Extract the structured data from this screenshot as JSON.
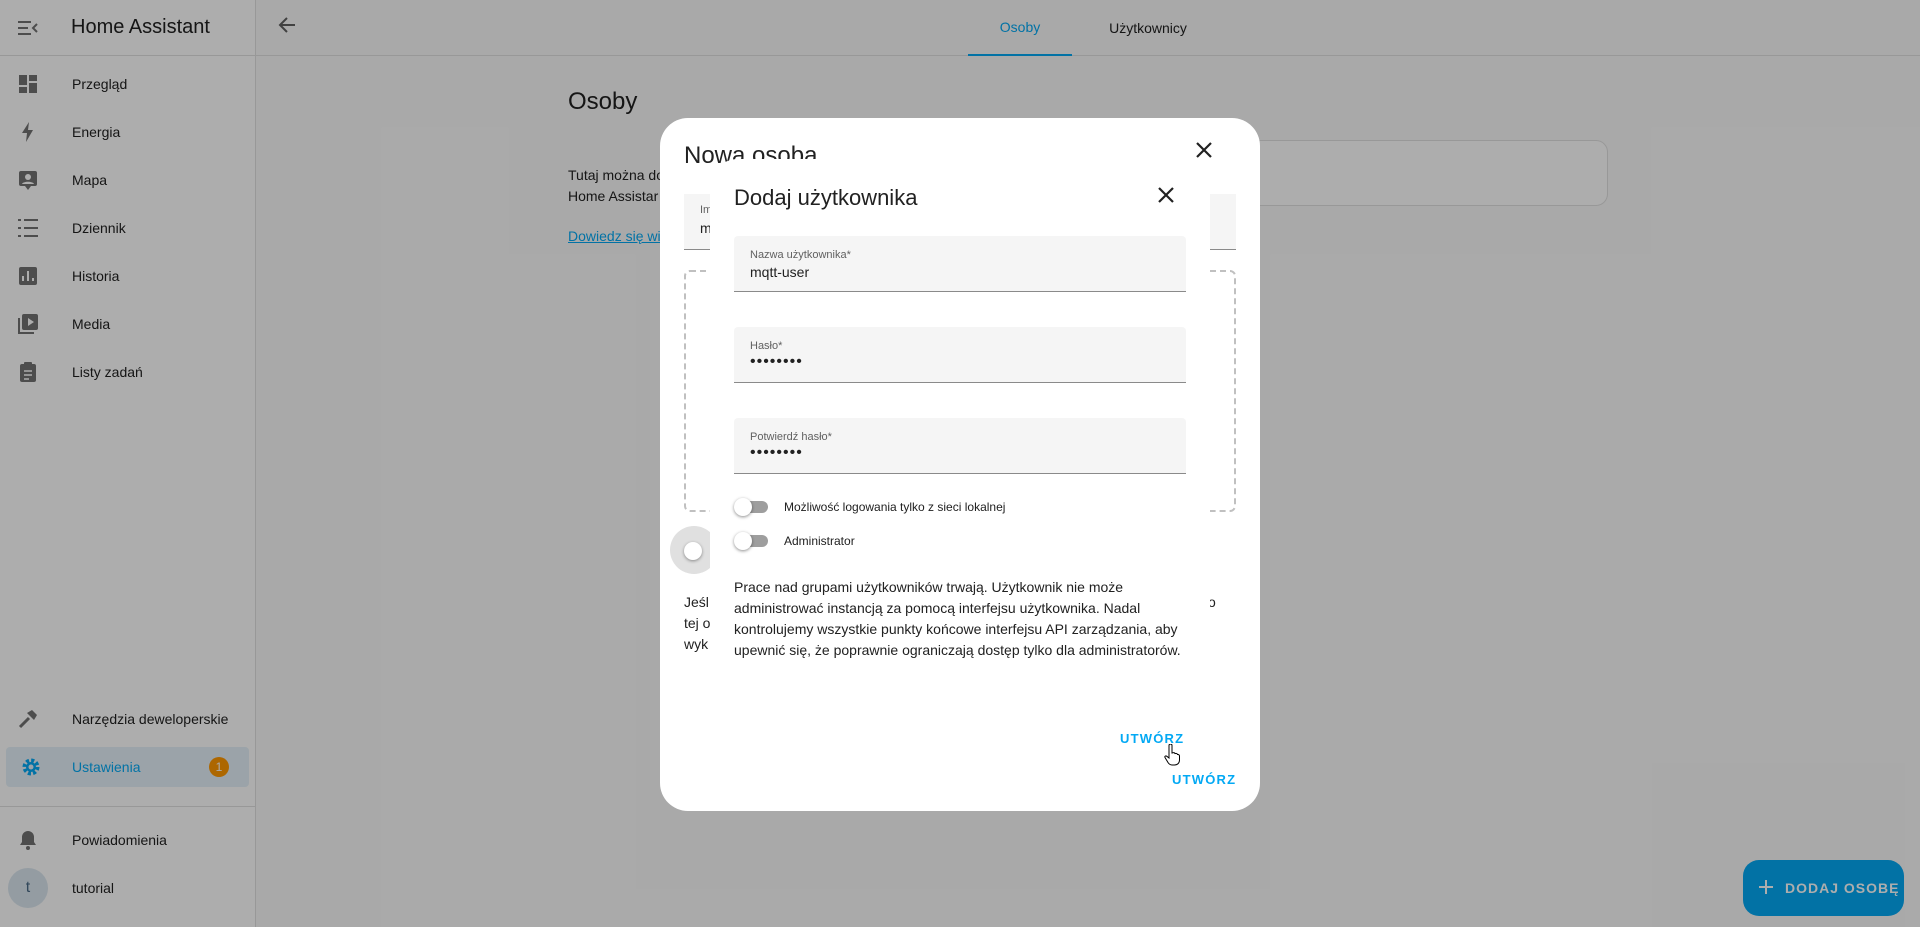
{
  "app": {
    "title": "Home Assistant"
  },
  "sidebar": {
    "items": [
      {
        "label": "Przegląd",
        "icon": "dashboard-icon"
      },
      {
        "label": "Energia",
        "icon": "lightning-icon"
      },
      {
        "label": "Mapa",
        "icon": "map-account-icon"
      },
      {
        "label": "Dziennik",
        "icon": "format-list-icon"
      },
      {
        "label": "Historia",
        "icon": "chart-box-icon"
      },
      {
        "label": "Media",
        "icon": "play-box-multiple-icon"
      },
      {
        "label": "Listy zadań",
        "icon": "clipboard-list-icon"
      }
    ],
    "dev_tools": "Narzędzia deweloperskie",
    "settings": {
      "label": "Ustawienia",
      "badge": "1"
    },
    "notifications": "Powiadomienia",
    "user": {
      "name": "tutorial",
      "initial": "t"
    }
  },
  "topbar": {
    "tabs": [
      "Osoby",
      "Użytkownicy"
    ],
    "active_tab": "Osoby"
  },
  "page": {
    "title": "Osoby",
    "desc_line1": "Tutaj można do",
    "desc_line2": "Home Assistar",
    "link": "Dowiedz się wię"
  },
  "fab": {
    "label": "DODAJ OSOBĘ"
  },
  "person_dialog": {
    "title": "Nowa osoba",
    "field_label": "Im",
    "field_value": "m",
    "text_line1": "Jeśl",
    "text_line2": "tej o",
    "text_line3": "wyk",
    "text_right": "o",
    "submit": "UTWÓRZ"
  },
  "user_dialog": {
    "title": "Dodaj użytkownika",
    "username": {
      "label": "Nazwa użytkownika*",
      "value": "mqtt-user"
    },
    "password": {
      "label": "Hasło*",
      "value": "••••••••"
    },
    "confirm_password": {
      "label": "Potwierdź hasło*",
      "value": "••••••••"
    },
    "local_only": {
      "label": "Możliwość logowania tylko z sieci lokalnej",
      "checked": false
    },
    "admin": {
      "label": "Administrator",
      "checked": false
    },
    "note": "Prace nad grupami użytkowników trwają. Użytkownik nie może administrować instancją za pomocą interfejsu użytkownika. Nadal kontrolujemy wszystkie punkty końcowe interfejsu API zarządzania, aby upewnić się, że poprawnie ograniczają dostęp tylko dla administratorów.",
    "submit": "UTWÓRZ"
  },
  "colors": {
    "accent": "#03a9f4",
    "badge": "#ff9800",
    "sidebar_icon": "#727272"
  }
}
